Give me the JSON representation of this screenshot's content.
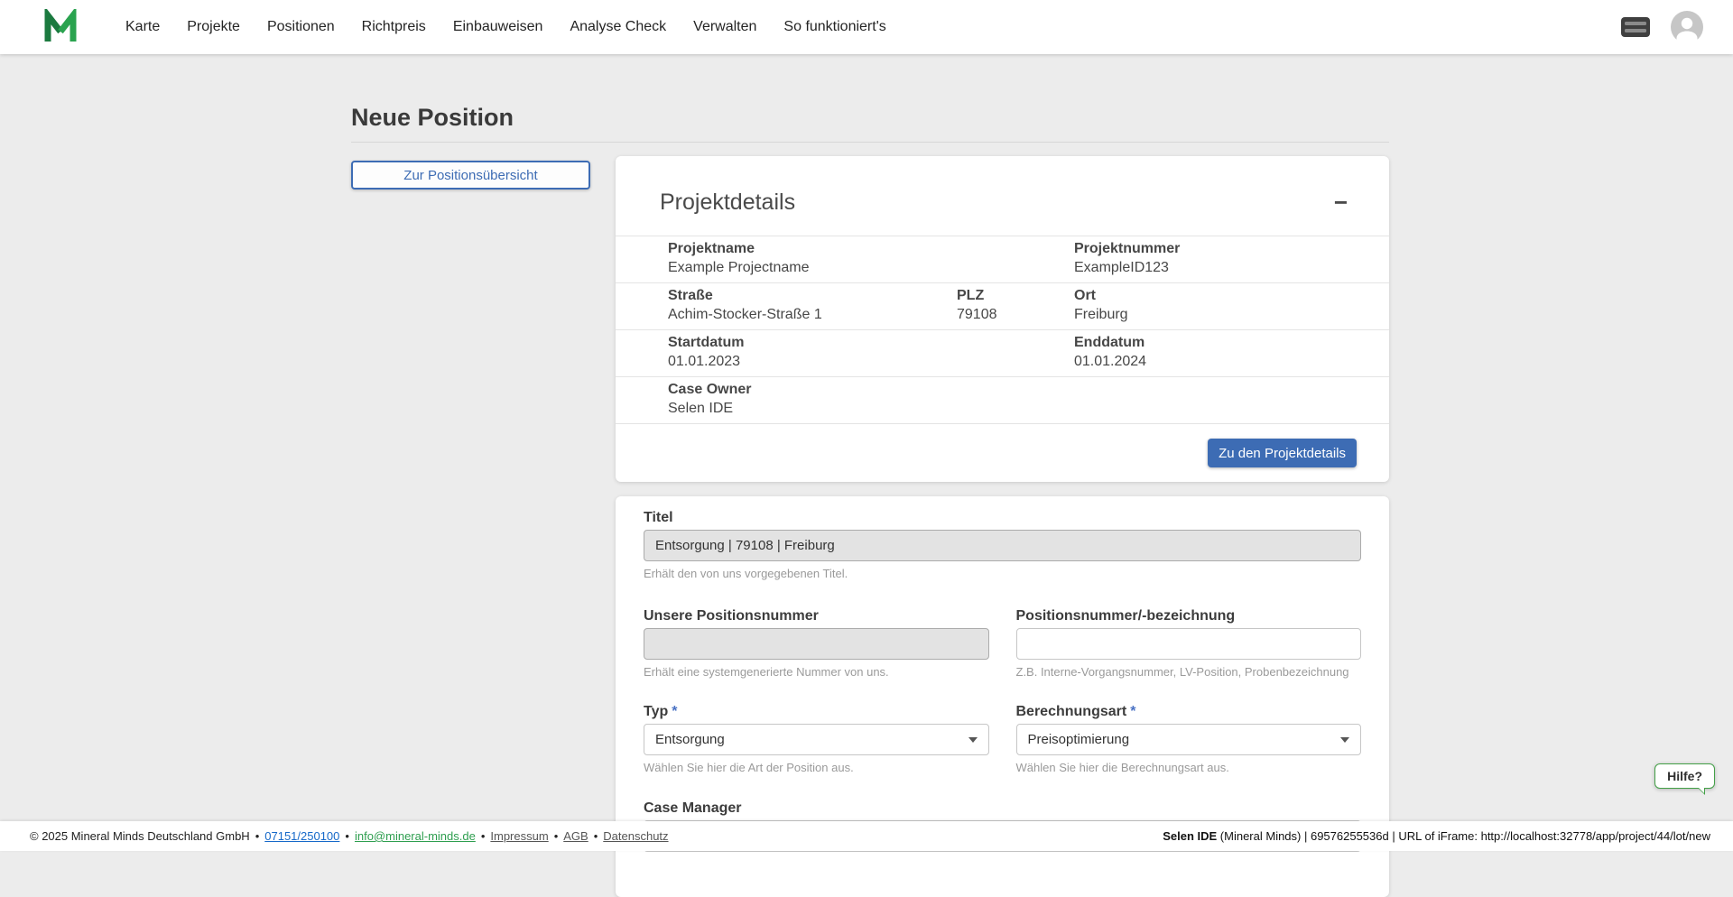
{
  "nav": {
    "items": [
      {
        "label": "Karte"
      },
      {
        "label": "Projekte"
      },
      {
        "label": "Positionen"
      },
      {
        "label": "Richtpreis"
      },
      {
        "label": "Einbauweisen"
      },
      {
        "label": "Analyse Check"
      },
      {
        "label": "Verwalten"
      },
      {
        "label": "So funktioniert's"
      }
    ]
  },
  "page": {
    "title": "Neue Position",
    "overview_button": "Zur Positionsübersicht"
  },
  "project_card": {
    "title": "Projektdetails",
    "collapse_symbol": "−",
    "rows": [
      {
        "cells": [
          {
            "label": "Projektname",
            "value": "Example Projectname"
          },
          {
            "label": "Projektnummer",
            "value": "ExampleID123"
          }
        ]
      },
      {
        "cells": [
          {
            "label": "Straße",
            "value": "Achim-Stocker-Straße 1"
          },
          {
            "label": "PLZ",
            "value": "79108"
          },
          {
            "label": "Ort",
            "value": "Freiburg"
          }
        ]
      },
      {
        "cells": [
          {
            "label": "Startdatum",
            "value": "01.01.2023"
          },
          {
            "label": "Enddatum",
            "value": "01.01.2024"
          }
        ]
      },
      {
        "cells": [
          {
            "label": "Case Owner",
            "value": "Selen IDE"
          }
        ]
      }
    ],
    "details_button": "Zu den Projektdetails"
  },
  "form": {
    "titel": {
      "label": "Titel",
      "value": "Entsorgung | 79108 | Freiburg",
      "helper": "Erhält den von uns vorgegebenen Titel."
    },
    "unsere_positionsnummer": {
      "label": "Unsere Positionsnummer",
      "value": "",
      "helper": "Erhält eine systemgenerierte Nummer von uns."
    },
    "positionsnummer": {
      "label": "Positionsnummer/-bezeichnung",
      "value": "",
      "helper": "Z.B. Interne-Vorgangsnummer, LV-Position, Probenbezeichnung"
    },
    "typ": {
      "label": "Typ",
      "required_mark": "*",
      "value": "Entsorgung",
      "helper": "Wählen Sie hier die Art der Position aus."
    },
    "berechnungsart": {
      "label": "Berechnungsart",
      "required_mark": "*",
      "value": "Preisoptimierung",
      "helper": "Wählen Sie hier die Berechnungsart aus."
    },
    "case_manager": {
      "label": "Case Manager",
      "value": ""
    }
  },
  "help": {
    "label": "Hilfe?"
  },
  "footer": {
    "copyright": "© 2025 Mineral Minds Deutschland GmbH",
    "separator": "•",
    "links": [
      {
        "label": "07151/250100"
      },
      {
        "label": "info@mineral-minds.de"
      },
      {
        "label": "Impressum"
      },
      {
        "label": "AGB"
      },
      {
        "label": "Datenschutz"
      }
    ],
    "session_info": {
      "user": "Selen IDE",
      "details": " (Mineral Minds) | 69576255536d | URL of iFrame: http://localhost:32778/app/project/44/lot/new"
    }
  },
  "colors": {
    "primary_blue": "#3d6cb4",
    "brand_green": "#2aa34f",
    "page_background": "#ececec"
  }
}
